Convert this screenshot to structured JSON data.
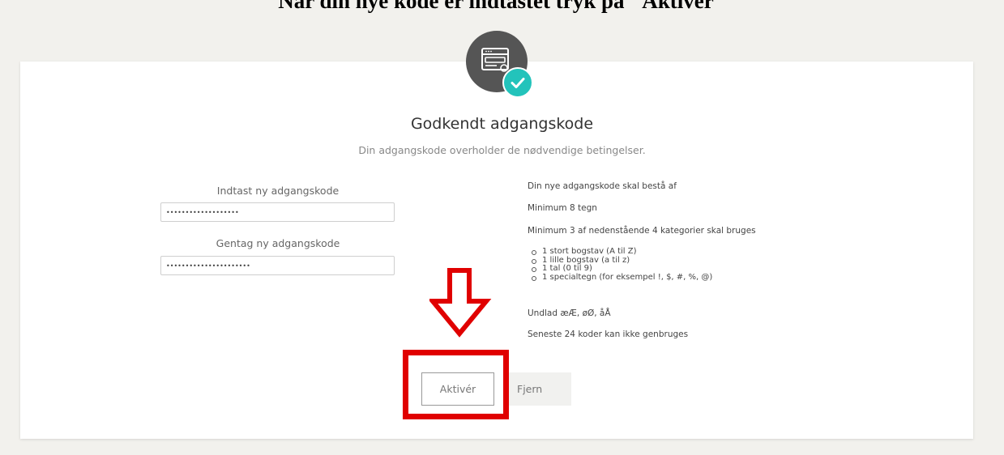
{
  "instruction_heading": "Når din nye kode er indtastet tryk på \"Aktivér\"",
  "status": {
    "title": "Godkendt adgangskode",
    "subtitle": "Din adgangskode overholder de nødvendige betingelser."
  },
  "form": {
    "new_password_label": "Indtast ny adgangskode",
    "new_password_value": "•••••••••••••••••••",
    "repeat_password_label": "Gentag ny adgangskode",
    "repeat_password_value": "••••••••••••••••••••••"
  },
  "requirements": {
    "heading": "Din nye adgangskode skal bestå af",
    "minimum_length": "Minimum 8 tegn",
    "categories_rule": "Minimum 3 af nedenstående 4 kategorier skal bruges",
    "categories": [
      "1 stort bogstav (A til Z)",
      "1 lille bogstav (a til z)",
      "1 tal (0 til 9)",
      "1 specialtegn (for eksempel !, $, #, %, @)"
    ],
    "exclusion": "Undlad æÆ, øØ, åÅ",
    "history": "Seneste 24 koder kan ikke genbruges"
  },
  "buttons": {
    "activate": "Aktivér",
    "remove": "Fjern"
  },
  "icons": {
    "password-card-icon": "card with password dots and cursor",
    "check-badge-icon": "checkmark"
  },
  "colors": {
    "accent_teal": "#23c3bb",
    "annotation_red": "#e00000",
    "icon_dark": "#555555"
  }
}
